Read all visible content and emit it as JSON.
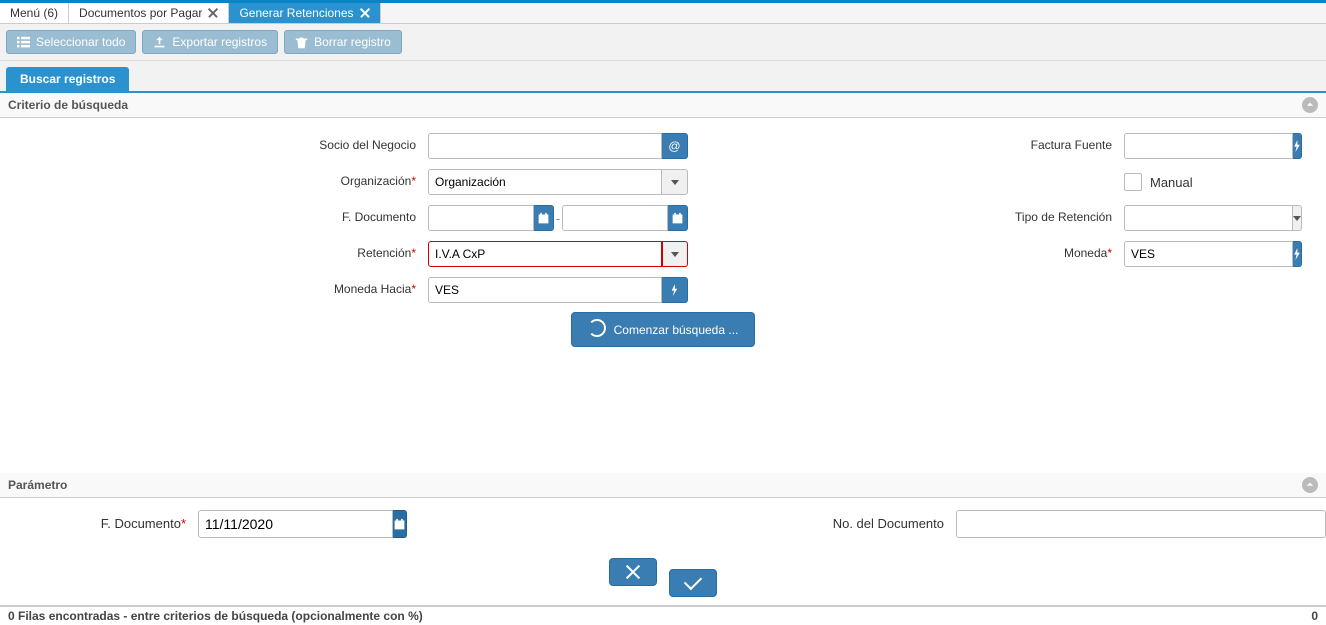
{
  "tabs": {
    "menu": {
      "label": "Menú (6)"
    },
    "docpay": {
      "label": "Documentos por Pagar"
    },
    "genret": {
      "label": "Generar Retenciones"
    }
  },
  "toolbar": {
    "select_all": "Seleccionar todo",
    "export": "Exportar registros",
    "delete": "Borrar registro"
  },
  "subtab": {
    "search": "Buscar registros"
  },
  "sections": {
    "criteria": "Criterio de búsqueda",
    "param": "Parámetro"
  },
  "labels": {
    "socio": "Socio del Negocio",
    "factura": "Factura Fuente",
    "organizacion": "Organización",
    "manual": "Manual",
    "fdoc": "F. Documento",
    "tiporet": "Tipo de Retención",
    "retencion": "Retención",
    "moneda": "Moneda",
    "monedahacia": "Moneda Hacia",
    "nodoc": "No. del Documento"
  },
  "values": {
    "socio": "",
    "factura": "",
    "organizacion_selected": "Organización",
    "fdoc_from": "",
    "fdoc_to": "",
    "tiporet_selected": "",
    "retencion_selected": "I.V.A CxP",
    "moneda_selected": "VES",
    "monedahacia_selected": "VES",
    "param_fdoc": "11/11/2020",
    "param_nodoc": ""
  },
  "buttons": {
    "begin_search": "Comenzar búsqueda ..."
  },
  "footer": {
    "status": "0 Filas encontradas - entre criterios de búsqueda (opcionalmente con %)",
    "count": "0"
  }
}
